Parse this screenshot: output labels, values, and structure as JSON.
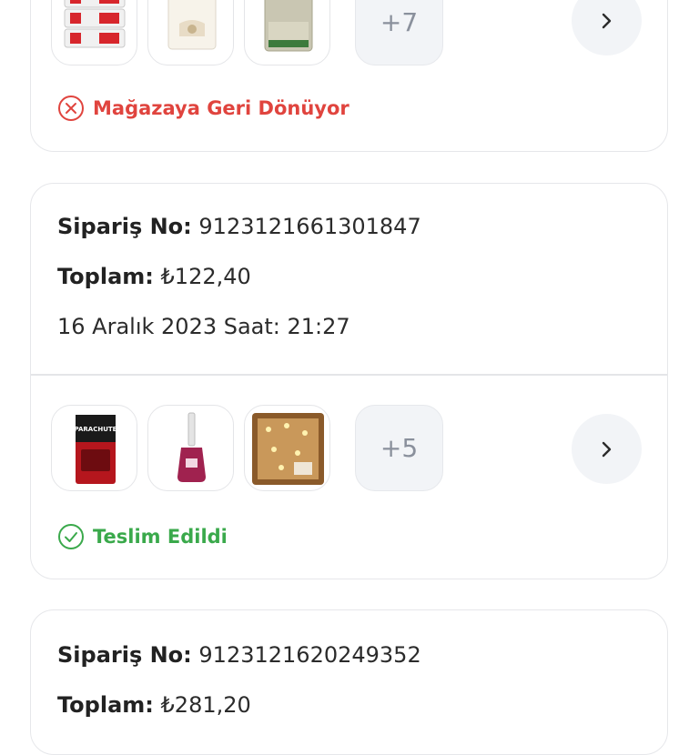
{
  "orders": [
    {
      "extra_count": "+7",
      "status": "Mağazaya Geri Dönüyor",
      "status_color": "#e0443e",
      "thumbnails": [
        "bulgur-pack-product",
        "petek-flour-product",
        "pirinc-rice-product"
      ]
    },
    {
      "order_no_label": "Sipariş No:",
      "order_no": "9123121661301847",
      "total_label": "Toplam:",
      "total": "₺122,40",
      "date": "16 Aralık 2023 Saat: 21:27",
      "extra_count": "+5",
      "status": "Teslim Edildi",
      "status_color": "#3aa94b",
      "thumbnails": [
        "parachute-product",
        "nail-polish-product",
        "fairy-lights-product"
      ]
    },
    {
      "order_no_label": "Sipariş No:",
      "order_no": "9123121620249352",
      "total_label": "Toplam:",
      "total": "₺281,20"
    }
  ]
}
